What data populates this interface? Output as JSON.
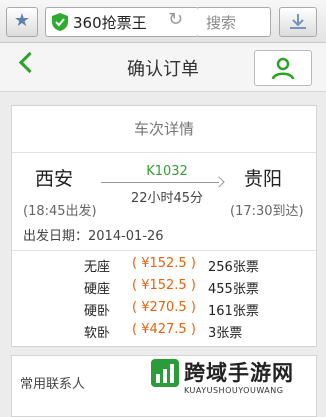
{
  "browser": {
    "address_text": "360抢票王",
    "search_placeholder": "搜索"
  },
  "header": {
    "title": "确认订单"
  },
  "trip": {
    "section_title": "车次详情",
    "from_city": "西安",
    "to_city": "贵阳",
    "train_number": "K1032",
    "duration": "22小时45分",
    "departure": "(18:45出发)",
    "arrival": "(17:30到达)",
    "date_line": "出发日期：2014-01-26"
  },
  "seats": [
    {
      "name": "无座",
      "price": "( ¥152.5 )",
      "count": "256张票"
    },
    {
      "name": "硬座",
      "price": "( ¥152.5 )",
      "count": "455张票"
    },
    {
      "name": "硬卧",
      "price": "( ¥270.5 )",
      "count": "161张票"
    },
    {
      "name": "软卧",
      "price": "( ¥427.5 )",
      "count": "3张票"
    }
  ],
  "contacts": {
    "label": "常用联系人"
  },
  "watermark": {
    "title": "跨域手游网",
    "subtitle": "KUAYUSHOUYOUWANG"
  },
  "colors": {
    "accent_green": "#29a329",
    "price_orange": "#e8610c"
  },
  "icons": [
    "star-icon",
    "shield-icon",
    "reload-icon",
    "download-icon",
    "back-arrow-icon",
    "user-icon"
  ]
}
